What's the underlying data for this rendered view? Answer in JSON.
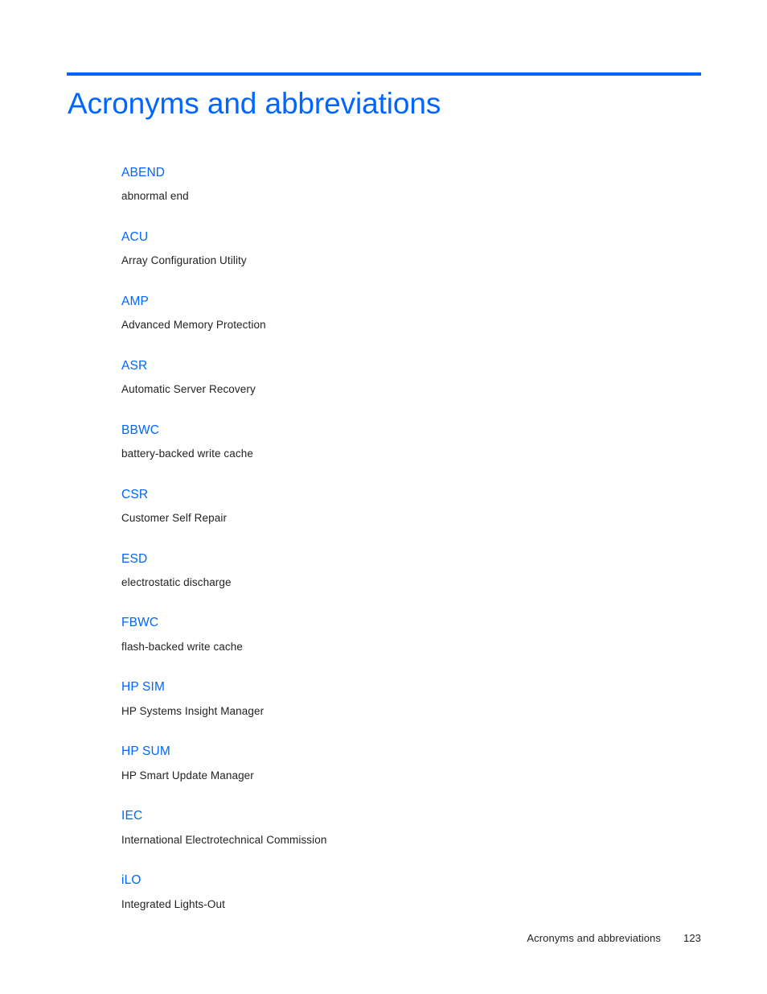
{
  "document": {
    "accent_color": "#0066ff",
    "body_text_color": "#231f20",
    "background_color": "#ffffff",
    "title": "Acronyms and abbreviations"
  },
  "heading": {
    "text": "Acronyms and abbreviations"
  },
  "glossary": {
    "entries": [
      {
        "term": "ABEND",
        "definition": "abnormal end"
      },
      {
        "term": "ACU",
        "definition": "Array Configuration Utility"
      },
      {
        "term": "AMP",
        "definition": "Advanced Memory Protection"
      },
      {
        "term": "ASR",
        "definition": "Automatic Server Recovery"
      },
      {
        "term": "BBWC",
        "definition": "battery-backed write cache"
      },
      {
        "term": "CSR",
        "definition": "Customer Self Repair"
      },
      {
        "term": "ESD",
        "definition": "electrostatic discharge"
      },
      {
        "term": "FBWC",
        "definition": "flash-backed write cache"
      },
      {
        "term": "HP SIM",
        "definition": "HP Systems Insight Manager"
      },
      {
        "term": "HP SUM",
        "definition": "HP Smart Update Manager"
      },
      {
        "term": "IEC",
        "definition": "International Electrotechnical Commission"
      },
      {
        "term": "iLO",
        "definition": "Integrated Lights-Out"
      }
    ]
  },
  "footer": {
    "section_title": "Acronyms and abbreviations",
    "page_number": "123"
  }
}
